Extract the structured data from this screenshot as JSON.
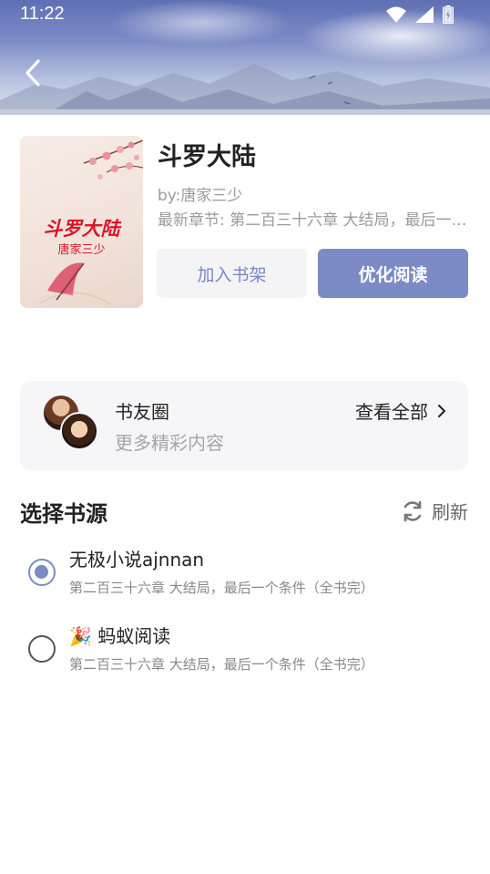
{
  "status_bar": {
    "time": "11:22"
  },
  "book": {
    "title": "斗罗大陆",
    "author": "by:唐家三少",
    "latest_chapter": "最新章节: 第二百三十六章 大结局，最后一个条件（全书完）",
    "cover_title": "斗罗大陆",
    "cover_author": "唐家三少",
    "add_shelf_label": "加入书架",
    "optimize_read_label": "优化阅读"
  },
  "circle": {
    "title": "书友圈",
    "subtitle": "更多精彩内容",
    "view_all_label": "查看全部"
  },
  "sources": {
    "title": "选择书源",
    "refresh_label": "刷新",
    "items": [
      {
        "name": "无极小说ajnnan",
        "chapter": "第二百三十六章 大结局，最后一个条件（全书完）",
        "selected": true
      },
      {
        "name": "🎉 蚂蚁阅读",
        "chapter": "第二百三十六章 大结局，最后一个条件（全书完）",
        "selected": false
      }
    ]
  },
  "colors": {
    "accent": "#7c8bc6",
    "cover_text": "#d8162a"
  }
}
